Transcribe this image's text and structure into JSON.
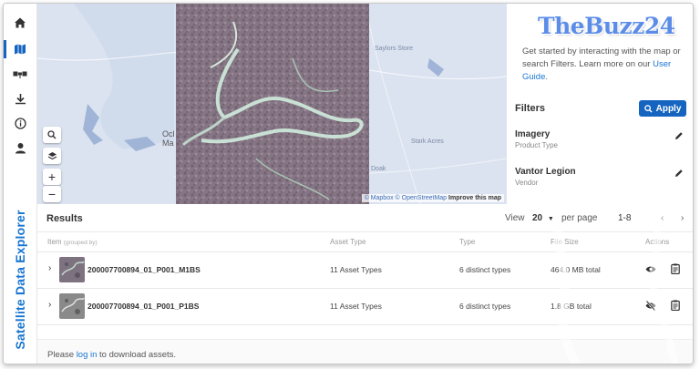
{
  "app": {
    "title": "Satellite Data Explorer",
    "watermark": "TheBuzz24"
  },
  "rail": {
    "items": [
      {
        "name": "home",
        "icon": "home-icon"
      },
      {
        "name": "map",
        "icon": "map-icon",
        "active": true
      },
      {
        "name": "satellite",
        "icon": "satellite-icon"
      },
      {
        "name": "download",
        "icon": "download-icon"
      },
      {
        "name": "info",
        "icon": "info-icon"
      },
      {
        "name": "account",
        "icon": "user-icon"
      }
    ]
  },
  "map": {
    "labels": {
      "place1": "Ocl",
      "place2": "Ma",
      "place3": "Saylors Store",
      "place4": "Stark Acres",
      "place5": "Doak"
    },
    "attribution": {
      "mapbox": "© Mapbox",
      "osm": "© OpenStreetMap",
      "improve": "Improve this map"
    }
  },
  "panel": {
    "intro_text": "Get started by interacting with the map or search Filters. Learn more on our ",
    "intro_link": "User Guide",
    "intro_end": ".",
    "filters_title": "Filters",
    "apply_label": "Apply",
    "filters": [
      {
        "title": "Imagery",
        "subtitle": "Product Type"
      },
      {
        "title": "Vantor Legion",
        "subtitle": "Vendor"
      }
    ]
  },
  "results": {
    "title": "Results",
    "view_label": "View",
    "per_page_value": "20",
    "per_page_label": "per page",
    "range": "1-8",
    "columns": {
      "item": "Item",
      "item_note": "(grouped by)",
      "asset_type": "Asset Type",
      "type": "Type",
      "file_size": "File Size",
      "actions": "Actions"
    },
    "rows": [
      {
        "name": "200007700894_01_P001_M1BS",
        "asset_type": "11 Asset Types",
        "type": "6 distinct types",
        "size": "464.0 MB total",
        "visibility_icon": "eye-icon"
      },
      {
        "name": "200007700894_01_P001_P1BS",
        "asset_type": "11 Asset Types",
        "type": "6 distinct types",
        "size": "1.8 GB total",
        "visibility_icon": "eye-off-icon"
      }
    ],
    "footer": {
      "prefix": "Please ",
      "link": "log in",
      "suffix": " to download assets."
    }
  },
  "colors": {
    "accent": "#1565c0",
    "link": "#1976d2",
    "map_water": "#dbe3f0"
  }
}
